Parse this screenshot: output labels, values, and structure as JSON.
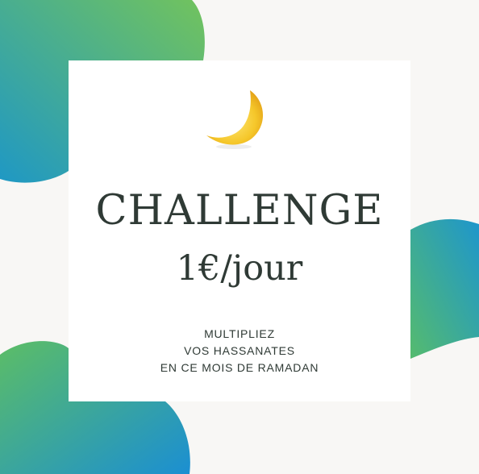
{
  "post": {
    "title": "CHALLENGE",
    "subtitle": "1€/jour",
    "tagline": [
      "MULTIPLIEZ",
      "VOS HASSANATES",
      "EN CE MOIS DE RAMADAN"
    ]
  },
  "colors": {
    "background": "#f8f7f5",
    "card": "#ffffff",
    "text": "#2f3a35",
    "gradient_blue": "#1e96c6",
    "gradient_green": "#6cc163",
    "moon_gold": "#f2c12e"
  },
  "icons": {
    "crescent": "crescent-moon-icon"
  }
}
